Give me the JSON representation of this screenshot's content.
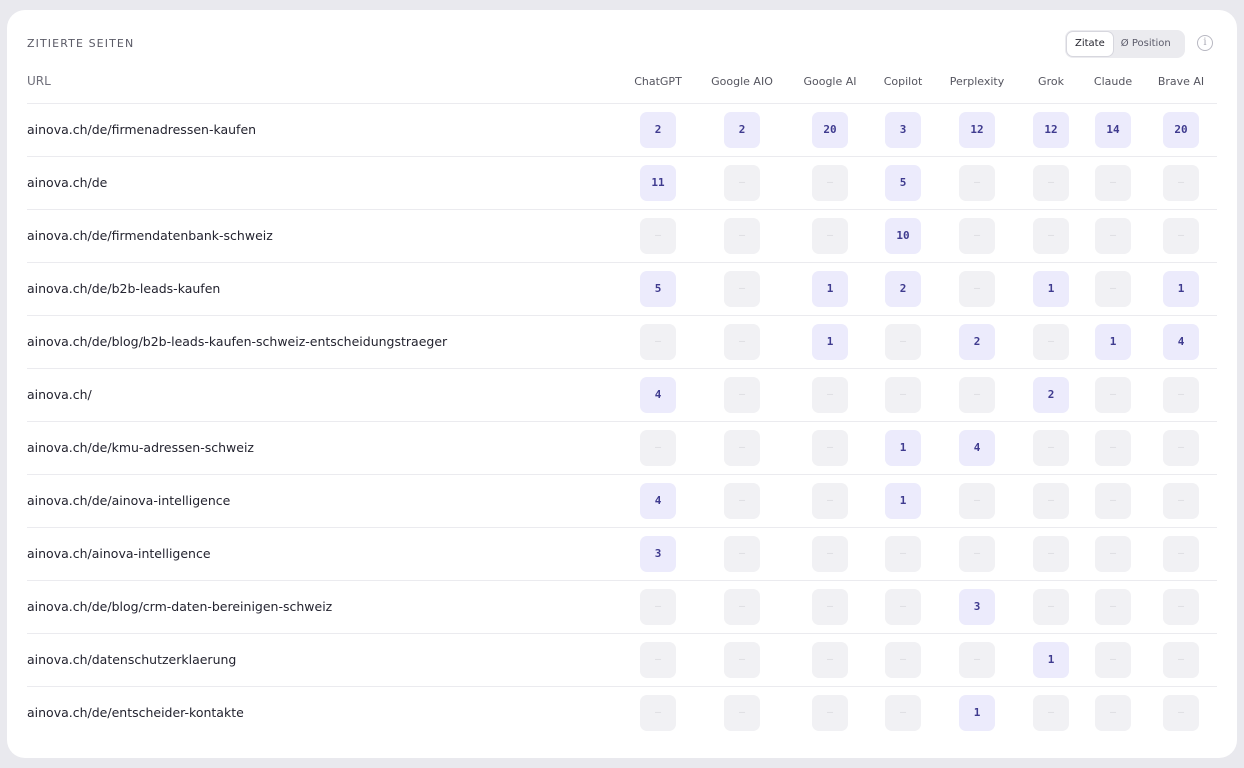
{
  "section_title": "ZITIERTE SEITEN",
  "toggle": {
    "options": [
      "Zitate",
      "Ø Position"
    ],
    "active": "Zitate"
  },
  "info_icon": "info-icon",
  "table": {
    "url_header": "URL",
    "engines": [
      "ChatGPT",
      "Google AIO",
      "Google AI",
      "Copilot",
      "Perplexity",
      "Grok",
      "Claude",
      "Brave AI"
    ],
    "empty_symbol": "—",
    "rows": [
      {
        "url": "ainova.ch/de/firmenadressen-kaufen",
        "values": [
          "2",
          "2",
          "20",
          "3",
          "12",
          "12",
          "14",
          "20"
        ]
      },
      {
        "url": "ainova.ch/de",
        "values": [
          "11",
          "",
          "",
          "5",
          "",
          "",
          "",
          ""
        ]
      },
      {
        "url": "ainova.ch/de/firmendatenbank-schweiz",
        "values": [
          "",
          "",
          "",
          "10",
          "",
          "",
          "",
          ""
        ]
      },
      {
        "url": "ainova.ch/de/b2b-leads-kaufen",
        "values": [
          "5",
          "",
          "1",
          "2",
          "",
          "1",
          "",
          "1"
        ]
      },
      {
        "url": "ainova.ch/de/blog/b2b-leads-kaufen-schweiz-entscheidungstraeger",
        "values": [
          "",
          "",
          "1",
          "",
          "2",
          "",
          "1",
          "4"
        ]
      },
      {
        "url": "ainova.ch/",
        "values": [
          "4",
          "",
          "",
          "",
          "",
          "2",
          "",
          ""
        ]
      },
      {
        "url": "ainova.ch/de/kmu-adressen-schweiz",
        "values": [
          "",
          "",
          "",
          "1",
          "4",
          "",
          "",
          ""
        ]
      },
      {
        "url": "ainova.ch/de/ainova-intelligence",
        "values": [
          "4",
          "",
          "",
          "1",
          "",
          "",
          "",
          ""
        ]
      },
      {
        "url": "ainova.ch/ainova-intelligence",
        "values": [
          "3",
          "",
          "",
          "",
          "",
          "",
          "",
          ""
        ]
      },
      {
        "url": "ainova.ch/de/blog/crm-daten-bereinigen-schweiz",
        "values": [
          "",
          "",
          "",
          "",
          "3",
          "",
          "",
          ""
        ]
      },
      {
        "url": "ainova.ch/datenschutzerklaerung",
        "values": [
          "",
          "",
          "",
          "",
          "",
          "1",
          "",
          ""
        ]
      },
      {
        "url": "ainova.ch/de/entscheider-kontakte",
        "values": [
          "",
          "",
          "",
          "",
          "1",
          "",
          "",
          ""
        ]
      }
    ]
  },
  "colors": {
    "value_bg": "#ecebfc",
    "value_text": "#3f3b8f",
    "empty_bg": "#f1f1f4"
  }
}
